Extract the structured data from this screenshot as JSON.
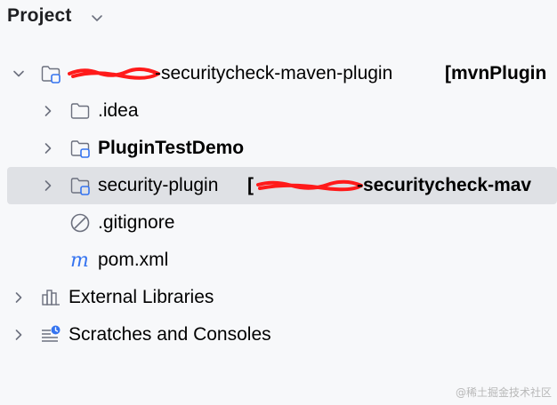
{
  "header": {
    "title": "Project"
  },
  "tree": {
    "root": {
      "label": "-securitycheck-maven-plugin",
      "module": "[mvnPlugin"
    },
    "items": [
      {
        "label": ".idea"
      },
      {
        "label": "PluginTestDemo"
      },
      {
        "label": "security-plugin",
        "bracket": "[",
        "module": "-securitycheck-mav"
      },
      {
        "label": ".gitignore"
      },
      {
        "label": "pom.xml"
      }
    ],
    "external_libraries": {
      "label": "External Libraries"
    },
    "scratches": {
      "label": "Scratches and Consoles"
    }
  },
  "watermark": "@稀土掘金技术社区",
  "colors": {
    "folder_stroke": "#6c707e",
    "module_badge": "#3574f0",
    "redaction": "#ff1a1a",
    "selection": "#dfe1e5"
  }
}
